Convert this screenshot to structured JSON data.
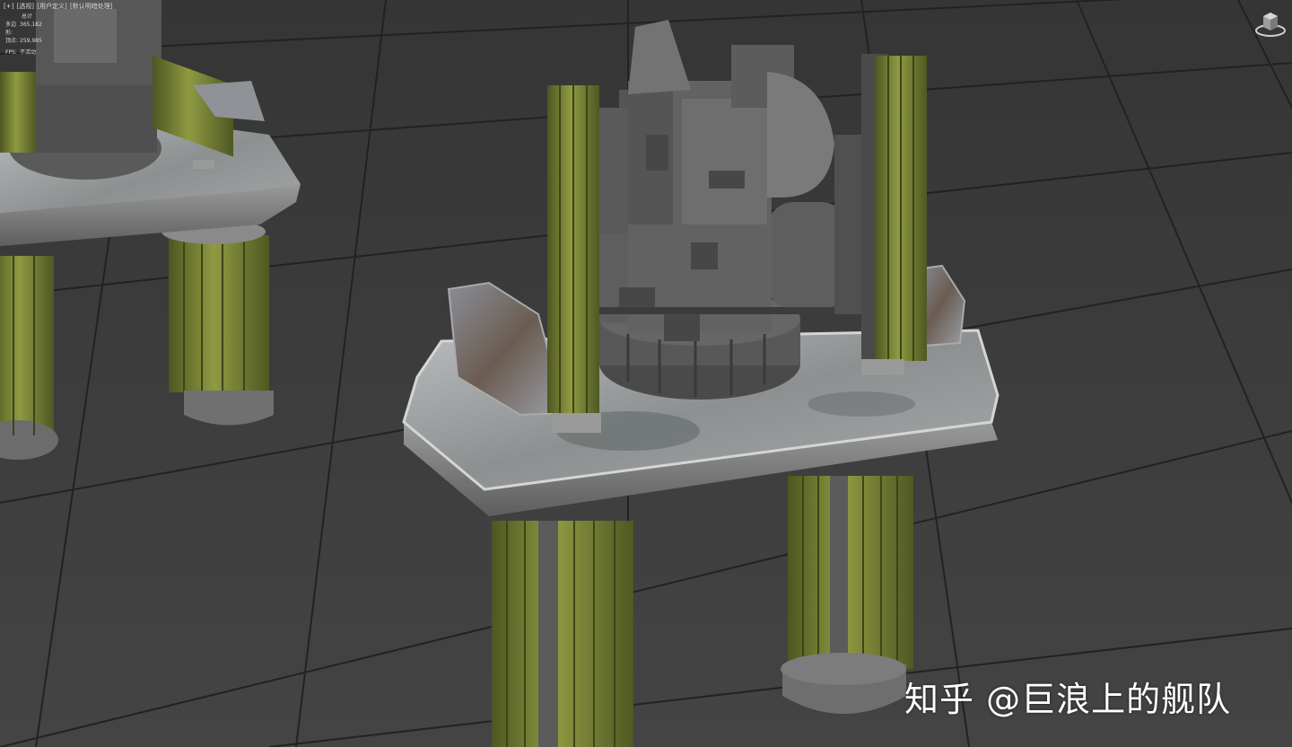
{
  "viewport": {
    "menu": [
      "[+]",
      "[透视]",
      "[用户定义]",
      "[默认明暗处理]"
    ],
    "stats": {
      "title": "总计",
      "polygons_label": "多边形:",
      "polygons_value": "365,182",
      "vertices_label": "顶点:",
      "vertices_value": "259,985",
      "fps_label": "FPS:",
      "fps_value": "不活动"
    },
    "viewcube_icon": "viewcube-icon"
  },
  "watermark": {
    "text": "知乎 @巨浪上的舰队"
  },
  "colors": {
    "background": "#3a3a3a",
    "grid": "#202020",
    "olive": "#6b7530",
    "olive_light": "#8f9a42",
    "metal": "#7a7a7a",
    "metal_dark": "#4a4a4a"
  }
}
